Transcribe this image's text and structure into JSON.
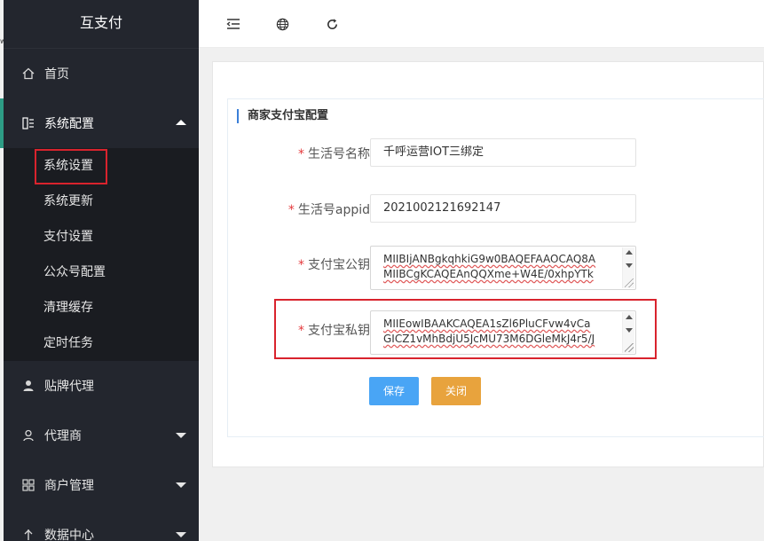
{
  "app": {
    "title": "互支付"
  },
  "sidebar": {
    "home": {
      "label": "首页",
      "icon": "home-icon"
    },
    "system_config": {
      "label": "系统配置",
      "icon": "config-icon",
      "expanded": true,
      "items": [
        {
          "label": "系统设置",
          "current": true
        },
        {
          "label": "系统更新"
        },
        {
          "label": "支付设置"
        },
        {
          "label": "公众号配置"
        },
        {
          "label": "清理缓存"
        },
        {
          "label": "定时任务"
        }
      ]
    },
    "brand_agent": {
      "label": "贴牌代理",
      "icon": "user-icon"
    },
    "agent": {
      "label": "代理商",
      "icon": "person-icon"
    },
    "merchant": {
      "label": "商户管理",
      "icon": "grid-icon"
    },
    "data_center": {
      "label": "数据中心"
    }
  },
  "header": {
    "icons": [
      "menu-toggle-icon",
      "globe-icon",
      "refresh-icon"
    ]
  },
  "form": {
    "title": "商家支付宝配置",
    "fields": {
      "life_name": {
        "label": "生活号名称",
        "value": "千呼运营IOT三绑定"
      },
      "life_appid": {
        "label": "生活号appid",
        "value": "2021002121692147"
      },
      "alipay_public_key": {
        "label": "支付宝公钥",
        "lines": [
          "MIIBIjANBgkqhkiG9w0BAQEFAAOCAQ8A",
          "MIIBCgKCAQEAnQQXme+W4E/0xhpYTk"
        ]
      },
      "alipay_private_key": {
        "label": "支付宝私钥",
        "lines": [
          "MIIEowIBAAKCAQEA1sZl6PluCFvw4vCa",
          "GICZ1vMhBdjU5JcMU73M6DGleMkJ4r5/J"
        ]
      }
    },
    "buttons": {
      "save": "保存",
      "close": "关闭"
    }
  },
  "colors": {
    "sidebar_bg": "#23262e",
    "accent_green": "#2d9c85",
    "save_blue": "#49a5f5",
    "close_orange": "#e8a33d",
    "highlight_red": "#d9232d"
  }
}
